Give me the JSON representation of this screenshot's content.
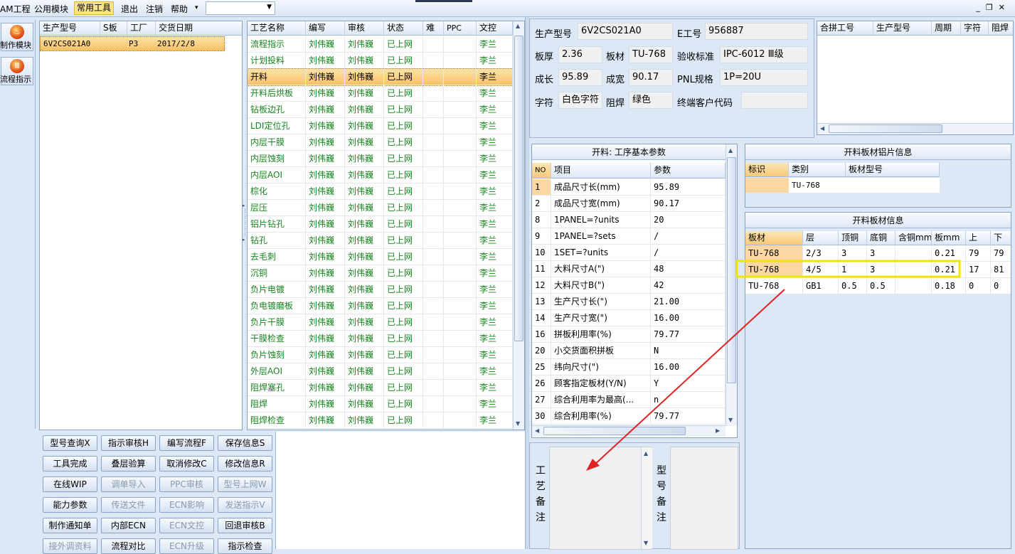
{
  "menu": {
    "items": [
      "AM工程",
      "公用模块",
      "常用工具",
      "退出",
      "注销",
      "帮助"
    ],
    "active": "常用工具",
    "combo_value": ""
  },
  "window_controls": {
    "minimize": "_",
    "restore": "❐",
    "close": "✕"
  },
  "left_toolbar": {
    "buttons": [
      {
        "label": "制作模块",
        "icon": "flame-icon"
      },
      {
        "label": "流程指示",
        "icon": "flow-icon"
      }
    ]
  },
  "order_grid": {
    "headers": [
      "生产型号",
      "S板",
      "工厂",
      "交货日期"
    ],
    "rows": [
      [
        "6V2CS021A0",
        "",
        "P3",
        "2017/2/8"
      ]
    ]
  },
  "process_grid": {
    "headers": [
      "工艺名称",
      "编写",
      "审核",
      "状态",
      "难",
      "PPC",
      "文控"
    ],
    "rows": [
      [
        "流程指示",
        "刘伟巍",
        "刘伟巍",
        "已上网",
        "",
        "",
        "李兰"
      ],
      [
        "计划投料",
        "刘伟巍",
        "刘伟巍",
        "已上网",
        "",
        "",
        "李兰"
      ],
      [
        "开料",
        "刘伟巍",
        "刘伟巍",
        "已上网",
        "",
        "",
        "李兰"
      ],
      [
        "开料后烘板",
        "刘伟巍",
        "刘伟巍",
        "已上网",
        "",
        "",
        "李兰"
      ],
      [
        "钻板边孔",
        "刘伟巍",
        "刘伟巍",
        "已上网",
        "",
        "",
        "李兰"
      ],
      [
        "LDI定位孔",
        "刘伟巍",
        "刘伟巍",
        "已上网",
        "",
        "",
        "李兰"
      ],
      [
        "内层干膜",
        "刘伟巍",
        "刘伟巍",
        "已上网",
        "",
        "",
        "李兰"
      ],
      [
        "内层蚀刻",
        "刘伟巍",
        "刘伟巍",
        "已上网",
        "",
        "",
        "李兰"
      ],
      [
        "内层AOI",
        "刘伟巍",
        "刘伟巍",
        "已上网",
        "",
        "",
        "李兰"
      ],
      [
        "棕化",
        "刘伟巍",
        "刘伟巍",
        "已上网",
        "",
        "",
        "李兰"
      ],
      [
        "层压",
        "刘伟巍",
        "刘伟巍",
        "已上网",
        "",
        "",
        "李兰"
      ],
      [
        "铝片钻孔",
        "刘伟巍",
        "刘伟巍",
        "已上网",
        "",
        "",
        "李兰"
      ],
      [
        "钻孔",
        "刘伟巍",
        "刘伟巍",
        "已上网",
        "",
        "",
        "李兰"
      ],
      [
        "去毛刺",
        "刘伟巍",
        "刘伟巍",
        "已上网",
        "",
        "",
        "李兰"
      ],
      [
        "沉铜",
        "刘伟巍",
        "刘伟巍",
        "已上网",
        "",
        "",
        "李兰"
      ],
      [
        "负片电镀",
        "刘伟巍",
        "刘伟巍",
        "已上网",
        "",
        "",
        "李兰"
      ],
      [
        "负电镀磨板",
        "刘伟巍",
        "刘伟巍",
        "已上网",
        "",
        "",
        "李兰"
      ],
      [
        "负片干膜",
        "刘伟巍",
        "刘伟巍",
        "已上网",
        "",
        "",
        "李兰"
      ],
      [
        "干膜检查",
        "刘伟巍",
        "刘伟巍",
        "已上网",
        "",
        "",
        "李兰"
      ],
      [
        "负片蚀刻",
        "刘伟巍",
        "刘伟巍",
        "已上网",
        "",
        "",
        "李兰"
      ],
      [
        "外层AOI",
        "刘伟巍",
        "刘伟巍",
        "已上网",
        "",
        "",
        "李兰"
      ],
      [
        "阻焊塞孔",
        "刘伟巍",
        "刘伟巍",
        "已上网",
        "",
        "",
        "李兰"
      ],
      [
        "阻焊",
        "刘伟巍",
        "刘伟巍",
        "已上网",
        "",
        "",
        "李兰"
      ],
      [
        "阻焊检查",
        "刘伟巍",
        "刘伟巍",
        "已上网",
        "",
        "",
        "李兰"
      ]
    ],
    "selected_index": 2
  },
  "action_buttons": [
    [
      "型号查询X",
      "指示审核H",
      "编写流程F",
      "保存信息S"
    ],
    [
      "工具完成",
      "叠层验算",
      "取消修改C",
      "修改信息R"
    ],
    [
      "在线WIP",
      "调单导入",
      "PPC审核",
      "型号上网W"
    ],
    [
      "能力参数",
      "传送文件",
      "ECN影响",
      "发送指示V"
    ],
    [
      "制作通知单",
      "内部ECN",
      "ECN文控",
      "回退审核B"
    ],
    [
      "接外调资料",
      "流程对比",
      "ECN升级",
      "指示检查"
    ]
  ],
  "disabled_buttons": [
    "调单导入",
    "PPC审核",
    "型号上网W",
    "传送文件",
    "ECN影响",
    "发送指示V",
    "ECN文控",
    "接外调资料",
    "ECN升级"
  ],
  "info": {
    "model_label": "生产型号",
    "model": "6V2CS021A0",
    "e_label": "E工号",
    "e_no": "956887",
    "thick_label": "板厚",
    "thick": "2.36",
    "material_label": "板材",
    "material": "TU-768",
    "std_label": "验收标准",
    "std": "IPC-6012 Ⅲ级",
    "len_label": "成长",
    "len": "95.89",
    "wid_label": "成宽",
    "wid": "90.17",
    "pnl_label": "PNL规格",
    "pnl": "1P=20U",
    "char_label": "字符",
    "char": "白色字符",
    "mask_label": "阻焊",
    "mask": "绿色",
    "cust_label": "终端客户代码",
    "cust": ""
  },
  "merge_grid": {
    "headers": [
      "合拼工号",
      "生产型号",
      "周期",
      "字符",
      "阻焊"
    ]
  },
  "params": {
    "title": "开料: 工序基本参数",
    "headers": [
      "NO",
      "项目",
      "参数"
    ],
    "rows": [
      [
        "1",
        "成品尺寸长(mm)",
        "95.89"
      ],
      [
        "2",
        "成品尺寸宽(mm)",
        "90.17"
      ],
      [
        "8",
        "1PANEL=?units",
        "20"
      ],
      [
        "9",
        "1PANEL=?sets",
        "/"
      ],
      [
        "10",
        "1SET=?units",
        "/"
      ],
      [
        "11",
        "大料尺寸A(\")",
        "48"
      ],
      [
        "12",
        "大料尺寸B(\")",
        "42"
      ],
      [
        "13",
        "生产尺寸长(\")",
        "21.00"
      ],
      [
        "14",
        "生产尺寸宽(\")",
        "16.00"
      ],
      [
        "16",
        "拼板利用率(%)",
        "79.77"
      ],
      [
        "20",
        "小交货面积拼板",
        "N"
      ],
      [
        "25",
        "纬向尺寸(\")",
        "16.00"
      ],
      [
        "26",
        "顾客指定板材(Y/N)",
        "Y"
      ],
      [
        "27",
        "综合利用率为最高(...",
        "n"
      ],
      [
        "30",
        "综合利用率(%)",
        "79.77"
      ]
    ]
  },
  "alu": {
    "title": "开料板材铝片信息",
    "headers": [
      "标识",
      "类别",
      "板材型号"
    ],
    "rows": [
      [
        "",
        "TU-768",
        ""
      ]
    ]
  },
  "board": {
    "title": "开料板材信息",
    "headers": [
      "板材",
      "层",
      "顶铜",
      "底铜",
      "含铜mm",
      "板mm",
      "上",
      "下"
    ],
    "rows": [
      [
        "TU-768",
        "2/3",
        "3",
        "3",
        "",
        "0.21",
        "79",
        "79"
      ],
      [
        "TU-768",
        "4/5",
        "1",
        "3",
        "",
        "0.21",
        "17",
        "81"
      ],
      [
        "TU-768",
        "GB1",
        "0.5",
        "0.5",
        "",
        "0.18",
        "0",
        "0"
      ]
    ]
  },
  "notes": {
    "process_label": "工艺备注",
    "model_label": "型号备注"
  },
  "colors": {
    "highlight_box": "#f0e600",
    "arrow": "#e02424",
    "status_green": "#17851f",
    "selection": "#f8c063"
  }
}
